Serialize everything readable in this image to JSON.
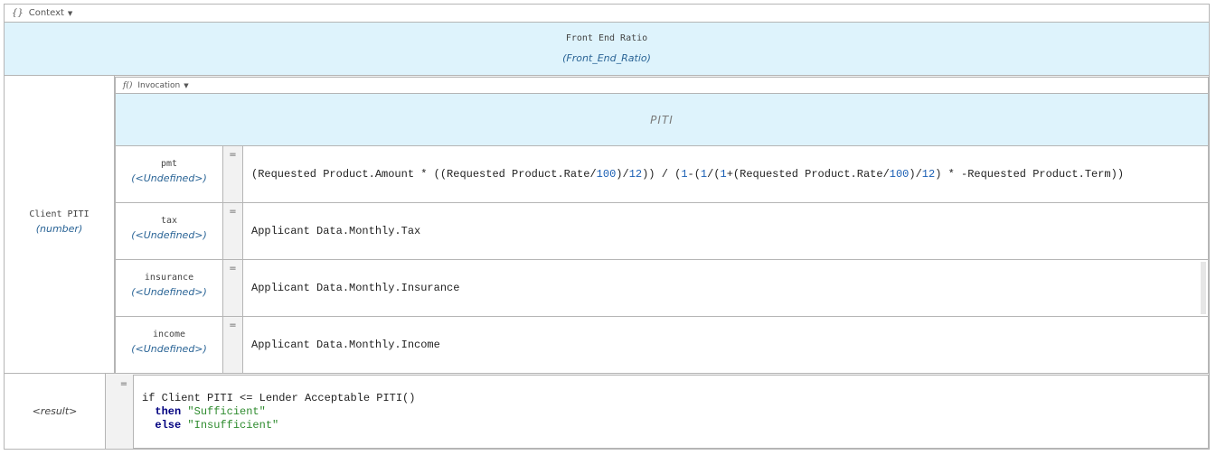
{
  "context_header": {
    "glyph": "{}",
    "label": "Context",
    "caret": "▼"
  },
  "title": {
    "name": "Front End Ratio",
    "type": "(Front_End_Ratio)"
  },
  "client_piti": {
    "name": "Client PITI",
    "type": "(number)"
  },
  "invocation": {
    "glyph": "f()",
    "label": "Invocation",
    "caret": "▼",
    "function_name": "PITI"
  },
  "equals": "=",
  "params": [
    {
      "name": "pmt",
      "type": "(<Undefined>)"
    },
    {
      "name": "tax",
      "type": "(<Undefined>)",
      "expr": "Applicant Data.Monthly.Tax"
    },
    {
      "name": "insurance",
      "type": "(<Undefined>)",
      "expr": "Applicant Data.Monthly.Insurance"
    },
    {
      "name": "income",
      "type": "(<Undefined>)",
      "expr": "Applicant Data.Monthly.Income"
    }
  ],
  "pmt_expr": {
    "p1": "(Requested Product.Amount * ((Requested Product.Rate/",
    "n1": "100",
    "p2": ")/",
    "n2": "12",
    "p3": ")) / (",
    "n3": "1",
    "p4": "-(",
    "n4": "1",
    "p5": "/(",
    "n5": "1",
    "p6": "+(Requested Product.Rate/",
    "n6": "100",
    "p7": ")/",
    "n7": "12",
    "p8": ") * -Requested Product.Term))"
  },
  "result": {
    "label": "<result>",
    "line1": "if Client PITI <= Lender Acceptable PITI()",
    "then_kw": "then",
    "then_val": "\"Sufficient\"",
    "else_kw": "else",
    "else_val": "\"Insufficient\""
  }
}
